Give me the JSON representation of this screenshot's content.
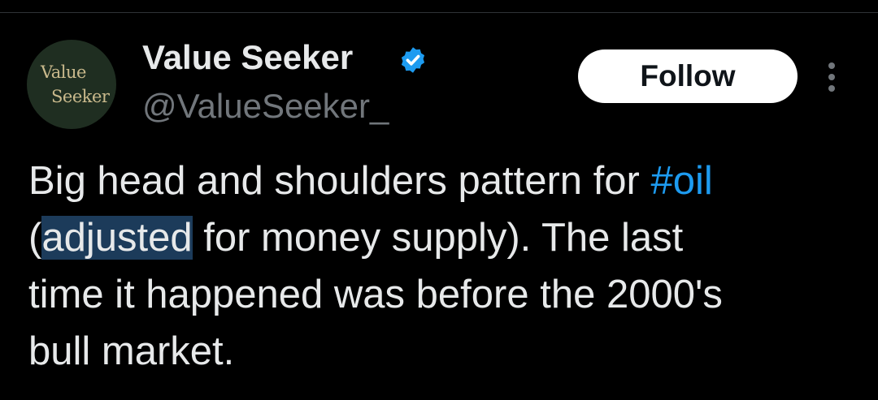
{
  "author": {
    "display_name": "Value Seeker",
    "handle": "@ValueSeeker_",
    "avatar_text": {
      "line1": "Value",
      "line2": "Seeker"
    },
    "verified_icon": "verified-badge-icon",
    "verified_color": "#1d9bf0"
  },
  "actions": {
    "follow_label": "Follow",
    "more_icon": "more-vertical-icon"
  },
  "tweet": {
    "line1_text": "Big head and shoulders pattern for ",
    "hashtag": "#oil",
    "line2_open": "(",
    "line2_selected": "adjusted",
    "line2_rest": " for money supply). The last",
    "line3": "time it happened was before the 2000's",
    "line4": "bull market."
  },
  "colors": {
    "background": "#000000",
    "text": "#e7e9ea",
    "muted": "#71767b",
    "link": "#1d9bf0",
    "selection": "#1c3b5a"
  }
}
